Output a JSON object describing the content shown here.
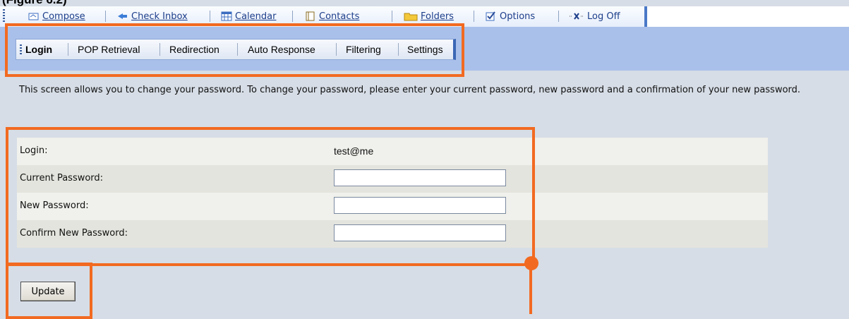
{
  "caption": "(Figure 6.2)",
  "toolbar": {
    "items": [
      {
        "label": "Compose",
        "icon": "compose-icon"
      },
      {
        "label": "Check Inbox",
        "icon": "check-inbox-icon"
      },
      {
        "label": "Calendar",
        "icon": "calendar-icon"
      },
      {
        "label": "Contacts",
        "icon": "contacts-icon"
      },
      {
        "label": "Folders",
        "icon": "folder-icon"
      },
      {
        "label": "Options",
        "icon": "options-checkbox-icon"
      },
      {
        "label": "Log Off",
        "icon": "log-off-icon"
      }
    ]
  },
  "subtabs": {
    "items": [
      "Login",
      "POP Retrieval",
      "Redirection",
      "Auto Response",
      "Filtering",
      "Settings"
    ],
    "active": "Login"
  },
  "description": "This screen allows you to change your password. To change your password, please enter your current password, new password and a confirmation of your new password.",
  "form": {
    "login_label": "Login:",
    "login_value": "test@me",
    "current_password_label": "Current Password:",
    "current_password_value": "",
    "new_password_label": "New Password:",
    "new_password_value": "",
    "confirm_password_label": "Confirm New Password:",
    "confirm_password_value": ""
  },
  "update_label": "Update",
  "colors": {
    "annotation": "#f26a21",
    "band": "#a9c0ea",
    "link": "#1d3e8a"
  }
}
